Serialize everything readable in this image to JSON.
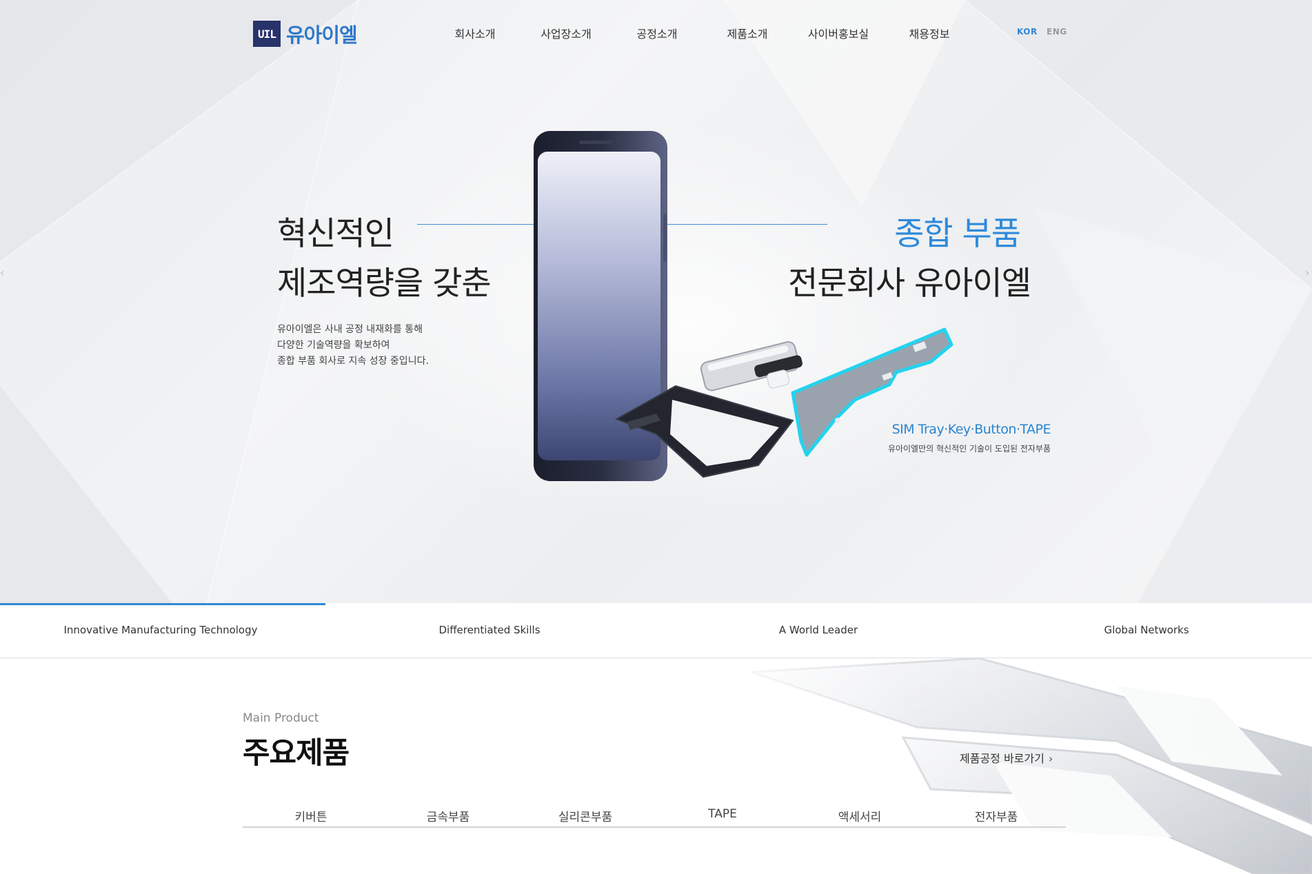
{
  "header": {
    "logo_mark": "UIL",
    "logo_text": "유아이엘",
    "nav": [
      "회사소개",
      "사업장소개",
      "공정소개",
      "제품소개",
      "사이버홍보실",
      "채용정보"
    ],
    "lang_kor": "KOR",
    "lang_eng": "ENG"
  },
  "hero": {
    "left_line1": "혁신적인",
    "left_line2": "제조역량을 갖춘",
    "right_line1": "종합 부품",
    "right_line2": "전문회사 유아이엘",
    "intro": [
      "유아이엘은 사내 공정 내재화를 통해",
      "다양한 기술역량을 확보하여",
      "종합 부품 회사로 지속 성장 중입니다."
    ],
    "product_label": "SIM Tray·Key·Button·TAPE",
    "product_sublabel": "유아이엘만의 혁신적인 기술이 도입된 전자부품",
    "accent_color": "#2f87d8"
  },
  "hero_tabs": [
    "Innovative Manufacturing Technology",
    "Differentiated Skills",
    "A World Leader",
    "Global Networks"
  ],
  "main_product": {
    "eyebrow": "Main Product",
    "title": "주요제품",
    "process_link": "제품공정 바로가기",
    "tabs": [
      "키버튼",
      "금속부품",
      "실리콘부품",
      "TAPE",
      "액세서리",
      "전자부품"
    ]
  }
}
